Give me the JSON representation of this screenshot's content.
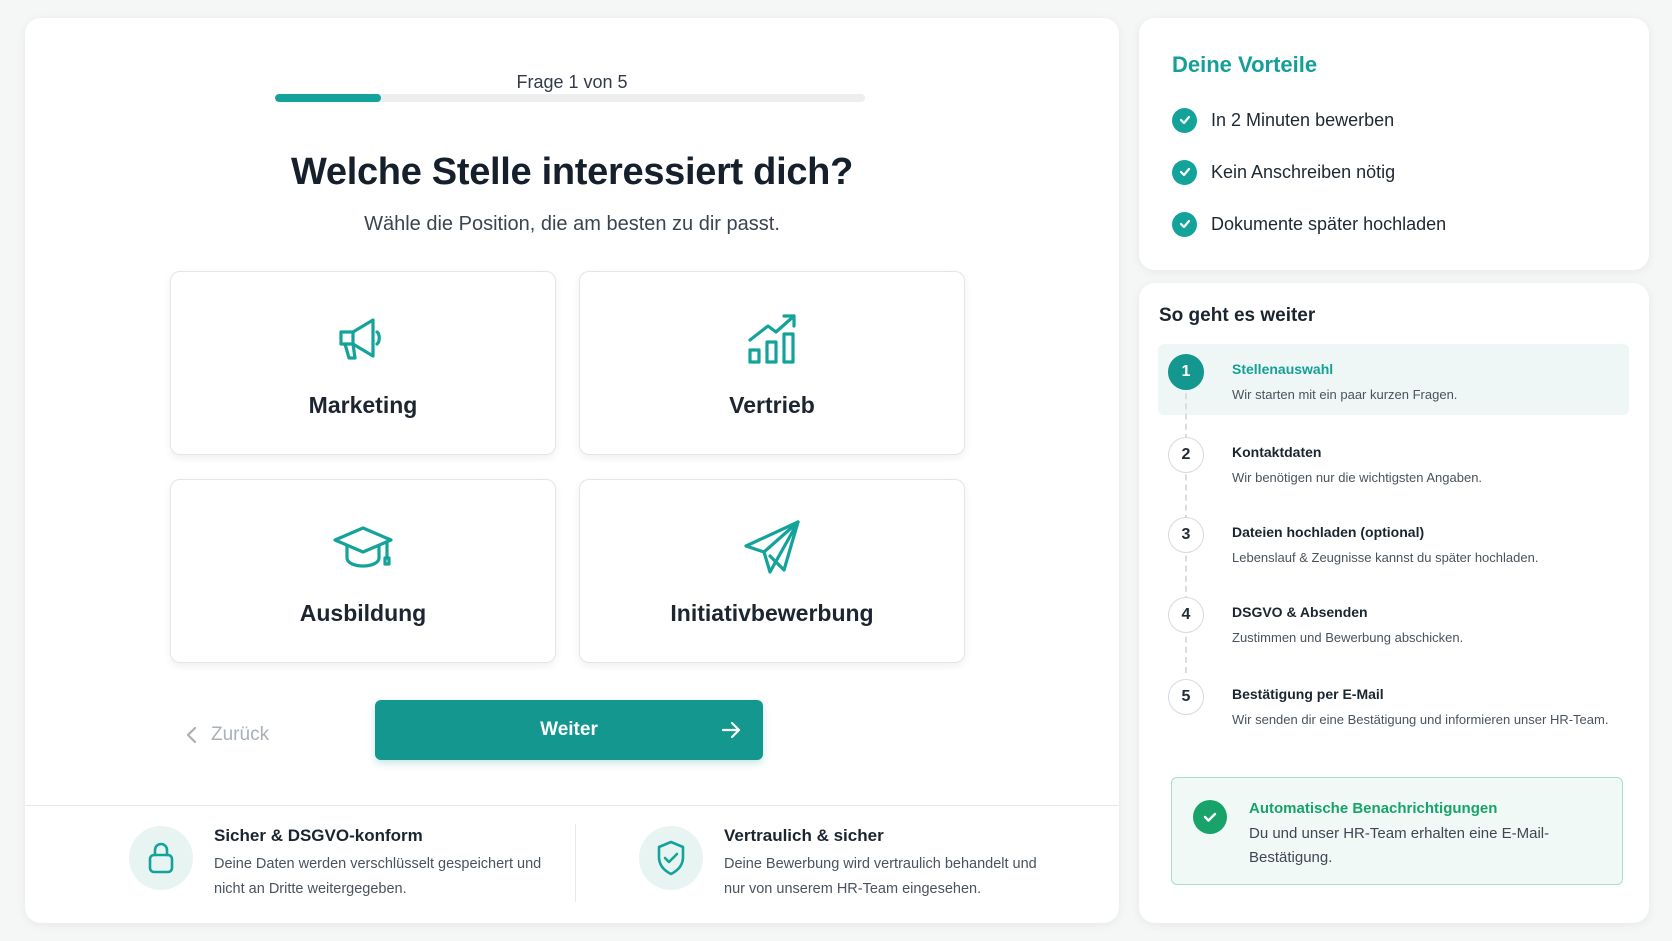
{
  "colors": {
    "accent": "#13978f",
    "accent_light": "#e8f4f2",
    "success": "#17a36a"
  },
  "progress": {
    "label": "Frage 1 von 5",
    "fraction": 0.18
  },
  "question": {
    "title": "Welche Stelle interessiert dich?",
    "subtitle": "Wähle die Position, die am besten zu dir passt."
  },
  "options": [
    {
      "label": "Marketing",
      "icon": "megaphone-icon"
    },
    {
      "label": "Vertrieb",
      "icon": "growth-chart-icon"
    },
    {
      "label": "Ausbildung",
      "icon": "graduation-cap-icon"
    },
    {
      "label": "Initiativbewerbung",
      "icon": "paper-plane-icon"
    }
  ],
  "nav": {
    "back_label": "Zurück",
    "next_label": "Weiter"
  },
  "trust": [
    {
      "title": "Sicher & DSGVO-konform",
      "text": "Deine Daten werden verschlüsselt gespeichert und nicht an Dritte weitergegeben.",
      "icon": "lock-icon"
    },
    {
      "title": "Vertraulich & sicher",
      "text": "Deine Bewerbung wird vertraulich behandelt und nur von unserem HR-Team eingesehen.",
      "icon": "shield-check-icon"
    }
  ],
  "benefits": {
    "title": "Deine Vorteile",
    "items": [
      "In 2 Minuten bewerben",
      "Kein Anschreiben nötig",
      "Dokumente später hochladen"
    ]
  },
  "steps": {
    "title": "So geht es weiter",
    "items": [
      {
        "num": "1",
        "title": "Stellenauswahl",
        "desc": "Wir starten mit ein paar kurzen Fragen.",
        "active": true
      },
      {
        "num": "2",
        "title": "Kontaktdaten",
        "desc": "Wir benötigen nur die wichtigsten Angaben.",
        "active": false
      },
      {
        "num": "3",
        "title": "Dateien hochladen (optional)",
        "desc": "Lebenslauf & Zeugnisse kannst du später hochladen.",
        "active": false
      },
      {
        "num": "4",
        "title": "DSGVO & Absenden",
        "desc": "Zustimmen und Bewerbung abschicken.",
        "active": false
      },
      {
        "num": "5",
        "title": "Bestätigung per E-Mail",
        "desc": "Wir senden dir eine Bestätigung und informieren unser HR-Team.",
        "active": false
      }
    ]
  },
  "notification": {
    "title": "Automatische Benachrichtigungen",
    "text": "Du und unser HR-Team erhalten eine E-Mail-Bestätigung."
  }
}
